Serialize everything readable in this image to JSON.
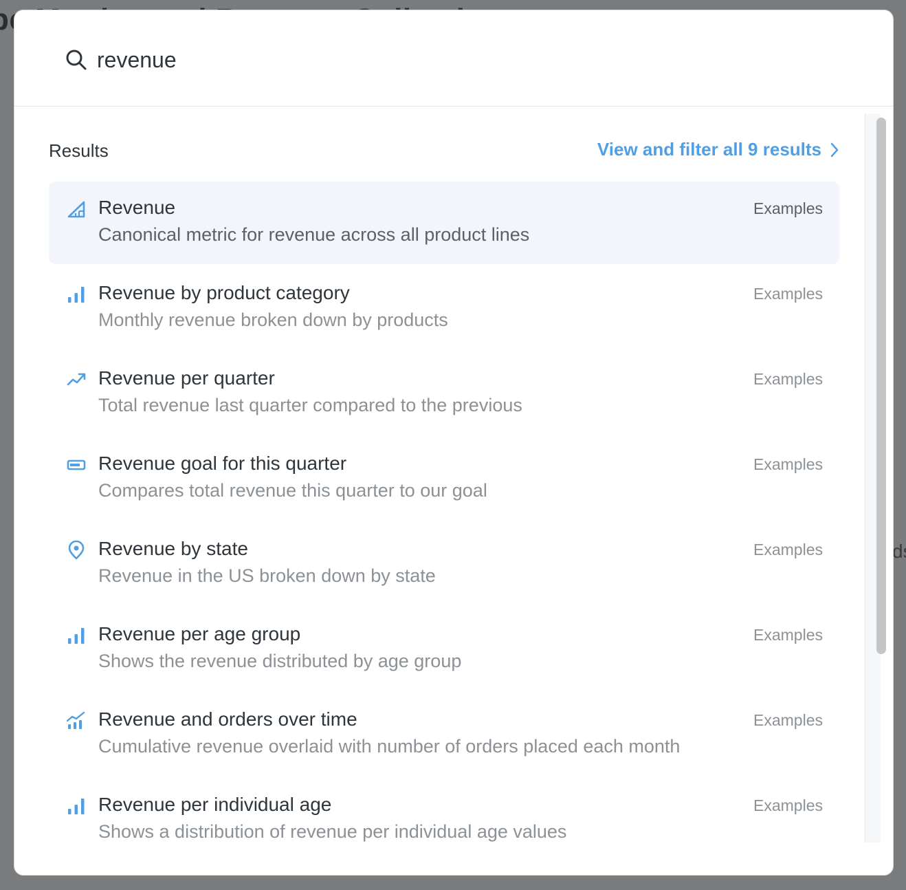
{
  "background": {
    "title_fragment": "pe   Metrics and Revenue Collection",
    "side_fragment": "ds"
  },
  "search": {
    "value": "revenue",
    "icon": "search-icon"
  },
  "results": {
    "label": "Results",
    "view_all": "View and filter all 9 results",
    "items": [
      {
        "icon": "metric-icon",
        "title": "Revenue",
        "description": "Canonical metric for revenue across all product lines",
        "tag": "Examples",
        "active": true
      },
      {
        "icon": "bar-chart-icon",
        "title": "Revenue by product category",
        "description": "Monthly revenue broken down by products",
        "tag": "Examples"
      },
      {
        "icon": "trend-icon",
        "title": "Revenue per quarter",
        "description": "Total revenue last quarter compared to the previous",
        "tag": "Examples"
      },
      {
        "icon": "progress-icon",
        "title": "Revenue goal for this quarter",
        "description": "Compares total revenue this quarter to our goal",
        "tag": "Examples"
      },
      {
        "icon": "map-pin-icon",
        "title": "Revenue by state",
        "description": "Revenue in the US broken down by state",
        "tag": "Examples"
      },
      {
        "icon": "bar-chart-icon",
        "title": "Revenue per age group",
        "description": "Shows the revenue distributed by age group",
        "tag": "Examples"
      },
      {
        "icon": "combo-chart-icon",
        "title": "Revenue and orders over time",
        "description": "Cumulative revenue overlaid with number of orders placed each month",
        "tag": "Examples"
      },
      {
        "icon": "bar-chart-icon",
        "title": "Revenue per individual age",
        "description": "Shows a distribution of revenue per individual age values",
        "tag": "Examples"
      }
    ]
  },
  "colors": {
    "accent": "#509ee3",
    "text_dark": "#2e353b",
    "text_muted": "#8c9196",
    "active_row": "#f2f5fa"
  }
}
